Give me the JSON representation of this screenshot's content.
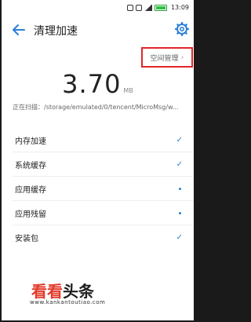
{
  "status": {
    "time": "13:09"
  },
  "header": {
    "title": "清理加速"
  },
  "space_button": {
    "label": "空间管理"
  },
  "summary": {
    "size_value": "3.70",
    "size_unit": "MB",
    "scanning_text": "正在扫描：/storage/emulated/0/tencent/MicroMsg/w..."
  },
  "items": [
    {
      "label": "内存加速",
      "state": "check"
    },
    {
      "label": "系统缓存",
      "state": "check"
    },
    {
      "label": "应用缓存",
      "state": "dot"
    },
    {
      "label": "应用残留",
      "state": "dot"
    },
    {
      "label": "安装包",
      "state": "check"
    }
  ],
  "watermark": {
    "brand_a": "看看",
    "brand_b": "头条",
    "url": "www.kankantoutiao.com"
  },
  "colors": {
    "accent": "#2a7fd8",
    "highlight_border": "#e0262a"
  },
  "icons": {
    "back": "arrow-left-icon",
    "settings": "gear-icon",
    "check": "check-icon"
  }
}
